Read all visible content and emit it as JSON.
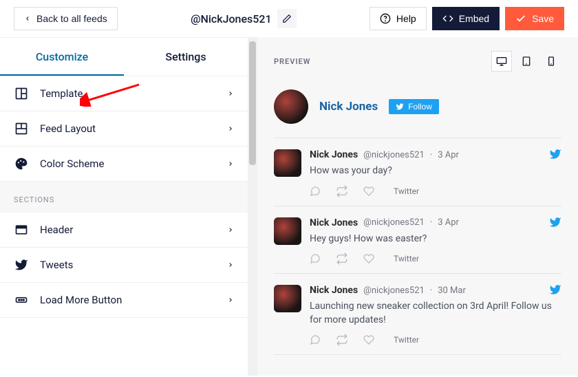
{
  "topbar": {
    "back_label": "Back to all feeds",
    "feed_handle": "@NickJones521",
    "help_label": "Help",
    "embed_label": "Embed",
    "save_label": "Save"
  },
  "tabs": {
    "customize": "Customize",
    "settings": "Settings"
  },
  "menu": {
    "template": "Template",
    "feed_layout": "Feed Layout",
    "color_scheme": "Color Scheme"
  },
  "sections_label": "SECTIONS",
  "sections": {
    "header": "Header",
    "tweets": "Tweets",
    "load_more": "Load More Button"
  },
  "preview": {
    "label": "PREVIEW",
    "profile_name": "Nick Jones",
    "follow_label": "Follow"
  },
  "tweets": [
    {
      "author": "Nick Jones",
      "handle": "@nickjones521",
      "date": "3 Apr",
      "text": "How was your day?",
      "source": "Twitter"
    },
    {
      "author": "Nick Jones",
      "handle": "@nickjones521",
      "date": "3 Apr",
      "text": "Hey guys! How was easter?",
      "source": "Twitter"
    },
    {
      "author": "Nick Jones",
      "handle": "@nickjones521",
      "date": "30 Mar",
      "text": "Launching new sneaker collection on 3rd April! Follow us for more updates!",
      "source": "Twitter"
    }
  ]
}
